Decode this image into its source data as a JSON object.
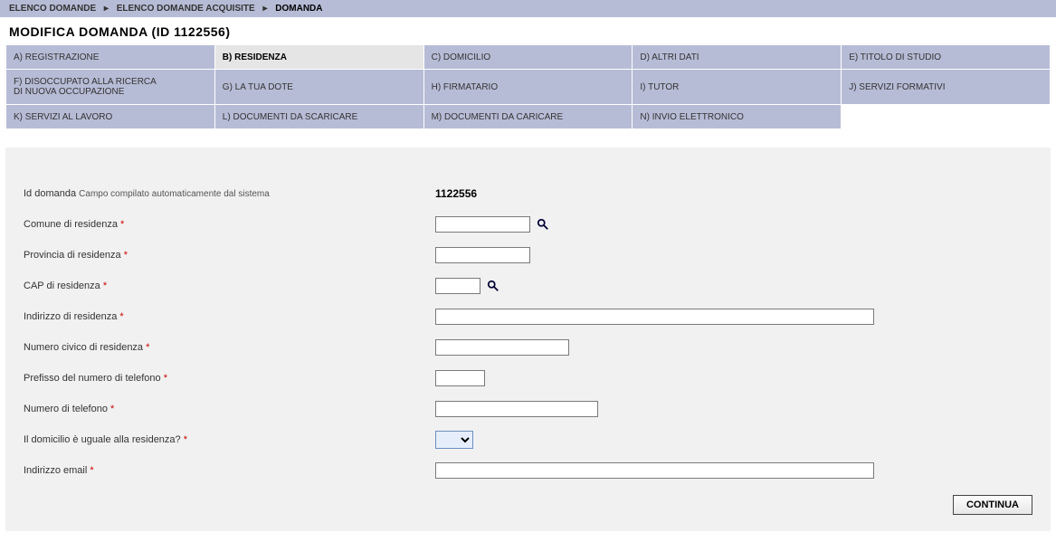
{
  "breadcrumb": {
    "items": [
      "ELENCO DOMANDE",
      "ELENCO DOMANDE ACQUISITE",
      "DOMANDA"
    ]
  },
  "page_title": "MODIFICA DOMANDA (ID 1122556)",
  "tabs": {
    "r1": [
      "A) REGISTRAZIONE",
      "B) RESIDENZA",
      "C) DOMICILIO",
      "D) ALTRI DATI",
      "E) TITOLO DI STUDIO"
    ],
    "r2": [
      "F) DISOCCUPATO ALLA RICERCA\nDI NUOVA OCCUPAZIONE",
      "G) LA TUA DOTE",
      "H) FIRMATARIO",
      "I) TUTOR",
      "J) SERVIZI FORMATIVI"
    ],
    "r3": [
      "K) SERVIZI AL LAVORO",
      "L) DOCUMENTI DA SCARICARE",
      "M) DOCUMENTI DA CARICARE",
      "N) INVIO ELETTRONICO",
      ""
    ],
    "active": "B) RESIDENZA"
  },
  "form": {
    "id_domanda_label": "Id domanda",
    "id_domanda_sub": "Campo compilato automaticamente dal sistema",
    "id_domanda_value": "1122556",
    "comune_label": "Comune di residenza",
    "comune_value": "",
    "provincia_label": "Provincia di residenza",
    "provincia_value": "",
    "cap_label": "CAP di residenza",
    "cap_value": "",
    "indirizzo_label": "Indirizzo di residenza",
    "indirizzo_value": "",
    "numero_civico_label": "Numero civico di residenza",
    "numero_civico_value": "",
    "prefisso_label": "Prefisso del numero di telefono",
    "prefisso_value": "",
    "telefono_label": "Numero di telefono",
    "telefono_value": "",
    "domicilio_uguale_label": "Il domicilio è uguale alla residenza?",
    "domicilio_uguale_value": "",
    "email_label": "Indirizzo email",
    "email_value": ""
  },
  "buttons": {
    "continua": "CONTINUA"
  },
  "required_marker": "*"
}
